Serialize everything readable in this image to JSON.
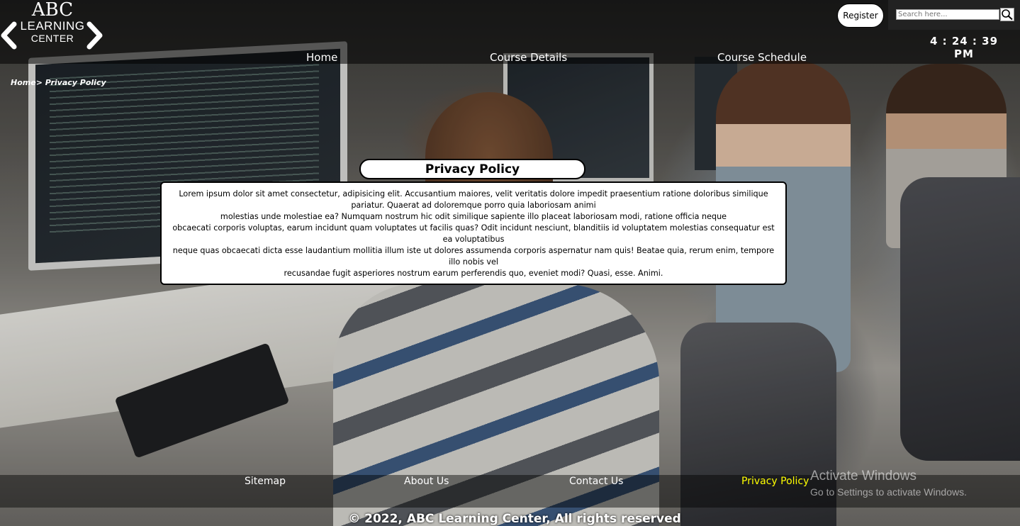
{
  "logo": {
    "line1": "ABC",
    "line2": "LEARNING",
    "line3": "CENTER"
  },
  "header": {
    "register_label": "Register",
    "search_placeholder": "Search here...",
    "clock": "4 : 24 : 39 PM"
  },
  "nav": {
    "items": [
      {
        "label": "Home"
      },
      {
        "label": "Course Details"
      },
      {
        "label": "Course Schedule"
      }
    ]
  },
  "breadcrumb": {
    "home": "Home",
    "separator": ">",
    "current": "Privacy Policy"
  },
  "main": {
    "title": "Privacy Policy",
    "paragraphs": [
      "Lorem ipsum dolor sit amet consectetur, adipisicing elit. Accusantium maiores, velit veritatis dolore impedit praesentium ratione doloribus similique pariatur. Quaerat ad doloremque porro quia laboriosam animi",
      "molestias unde molestiae ea? Numquam nostrum hic odit similique sapiente illo placeat laboriosam modi, ratione officia neque",
      "obcaecati corporis voluptas, earum incidunt quam voluptates ut facilis quas? Odit incidunt nesciunt, blanditiis id voluptatem molestias consequatur est ea voluptatibus",
      "neque quas obcaecati dicta esse laudantium mollitia illum iste ut dolores assumenda corporis aspernatur nam quis! Beatae quia, rerum enim, tempore illo nobis vel",
      "recusandae fugit asperiores nostrum earum perferendis quo, eveniet modi? Quasi, esse. Animi."
    ]
  },
  "footer": {
    "links": [
      {
        "label": "Sitemap"
      },
      {
        "label": "About Us"
      },
      {
        "label": "Contact Us"
      },
      {
        "label": "Privacy Policy"
      }
    ],
    "copyright": "© 2022, ABC Learning Center, All rights reserved",
    "active_color": "#ffff00"
  },
  "os_overlay": {
    "title": "Activate Windows",
    "subtitle": "Go to Settings to activate Windows."
  }
}
